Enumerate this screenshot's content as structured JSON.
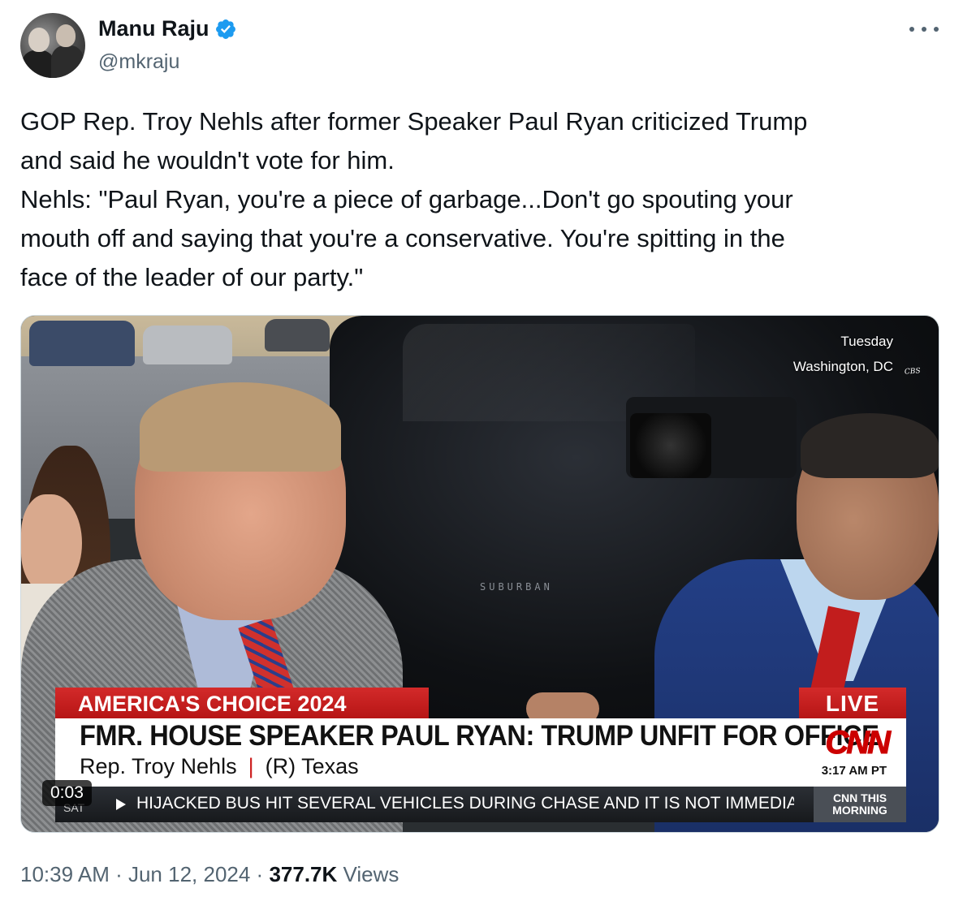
{
  "author": {
    "display_name": "Manu Raju",
    "handle": "@mkraju",
    "verified": true
  },
  "tweet": {
    "lines": [
      "GOP Rep. Troy Nehls after former Speaker Paul Ryan criticized Trump",
      "and said he wouldn't vote for him.",
      "Nehls: \"Paul Ryan, you're a piece of garbage...Don't go spouting your",
      "mouth off and saying that you're a conservative. You're spitting in the",
      "face of the leader of our party.\""
    ]
  },
  "video": {
    "elapsed": "0:03",
    "dateline_day": "Tuesday",
    "dateline_place": "Washington, DC",
    "background_text": "SUBURBAN",
    "mic_flag_text": "CBS",
    "chyron": {
      "banner": "AMERICA'S CHOICE 2024",
      "live": "LIVE",
      "headline": "FMR. HOUSE SPEAKER PAUL RYAN: TRUMP UNFIT FOR OFFICE",
      "name": "Rep. Troy Nehls",
      "separator": "|",
      "party_state": "(R) Texas",
      "network": "CNN",
      "clock": "3:17 AM PT",
      "ticker": "HIJACKED BUS HIT SEVERAL VEHICLES DURING CHASE AND IT IS NOT IMMEDIA",
      "ticker_label": "SAT",
      "show_line1": "CNN THIS",
      "show_line2": "MORNING"
    }
  },
  "meta": {
    "time": "10:39 AM",
    "dot1": " · ",
    "date": "Jun 12, 2024",
    "dot2": " · ",
    "views_count": "377.7K",
    "views_label": " Views"
  },
  "colors": {
    "verified_blue": "#1d9bf0",
    "cnn_red": "#cc0000",
    "secondary_text": "#536471"
  }
}
